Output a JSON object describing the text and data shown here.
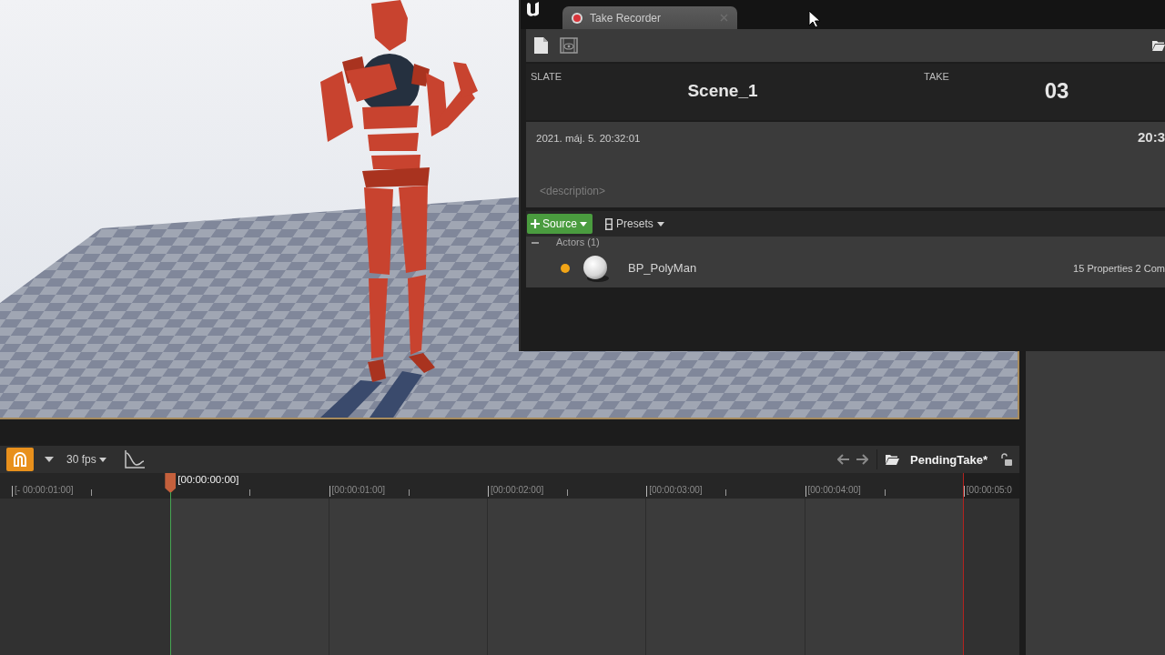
{
  "take_recorder": {
    "tab": {
      "title": "Take Recorder"
    },
    "slate": {
      "label": "SLATE",
      "value": "Scene_1"
    },
    "take": {
      "label": "TAKE",
      "value": "03"
    },
    "timestamp": "2021. máj. 5. 20:32:01",
    "timestamp_end": "20:3",
    "description": {
      "placeholder": "<description>"
    },
    "source_button": "Source",
    "presets_button": "Presets",
    "sources": [
      {
        "label": "Actors (1)",
        "expanded": true,
        "children": [
          {
            "name": "BP_PolyMan",
            "color": "#f2a516",
            "summary": "15 Properties 2 Com"
          }
        ]
      }
    ]
  },
  "sequencer": {
    "snap": {
      "on": true
    },
    "frame_rate": "30 fps",
    "take_name": "PendingTake*",
    "ruler": [
      {
        "kind": "tick",
        "label": "[- 00:00:01:00]"
      },
      {
        "kind": "playhead",
        "label": "[00:00:00:00]"
      },
      {
        "kind": "tick",
        "label": "[00:00:01:00]"
      },
      {
        "kind": "tick",
        "label": "[00:00:02:00]"
      },
      {
        "kind": "tick",
        "label": "[00:00:03:00]"
      },
      {
        "kind": "tick",
        "label": "[00:00:04:00]"
      },
      {
        "kind": "tick",
        "label": "[00:00:05:0"
      }
    ]
  }
}
